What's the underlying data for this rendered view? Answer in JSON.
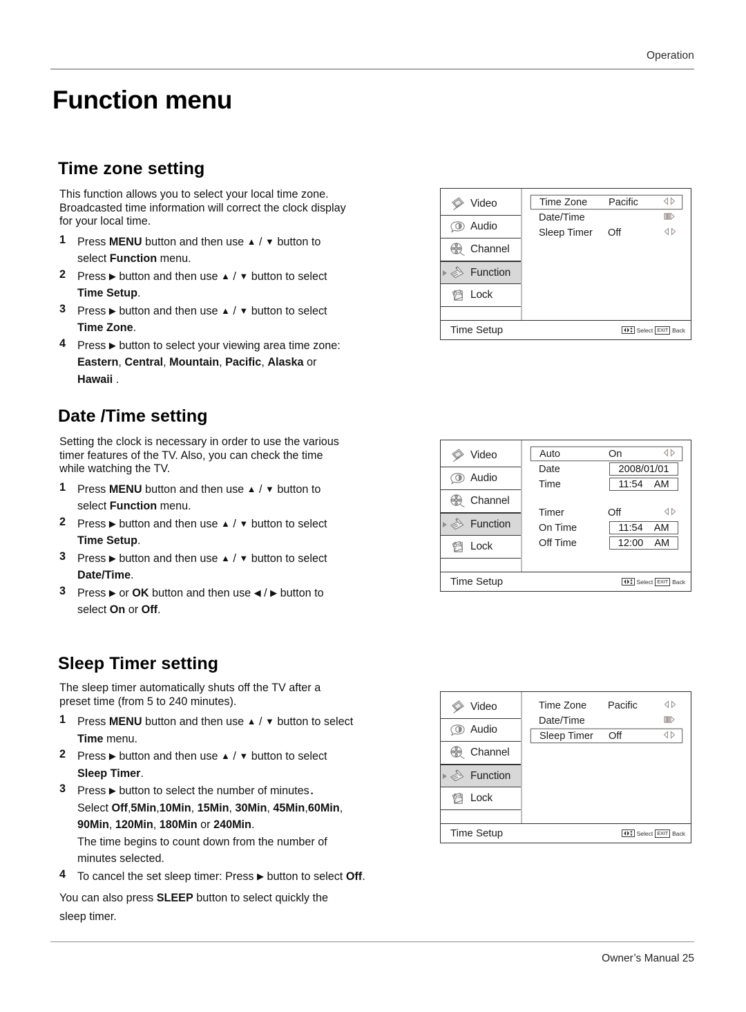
{
  "page": {
    "header_right": "Operation",
    "footer_right": "Owner’s Manual 25",
    "title": "Function menu"
  },
  "sections": [
    {
      "heading": "Time zone setting",
      "intro": [
        "This function allows you to select your local time zone.",
        "Broadcasted time information will correct the clock display",
        "for your local time."
      ],
      "steps": [
        {
          "num": "1",
          "lines": [
            "Press MENU button and then use ▲ / ▼ button to",
            "select Function menu."
          ]
        },
        {
          "num": "2",
          "lines": [
            "Press ▶ button and then use ▲ / ▼ button to select",
            "Time Setup."
          ]
        },
        {
          "num": "3",
          "lines": [
            "Press ▶ button and then use ▲ / ▼ button to select",
            "Time Zone."
          ]
        },
        {
          "num": "4",
          "lines": [
            "Press ▶ button to select your viewing area time zone:",
            "Eastern, Central, Mountain, Pacific, Alaska or",
            "Hawaii ."
          ]
        }
      ]
    },
    {
      "heading": "Date /Time setting",
      "intro": [
        "Setting the clock is necessary in order to use the various",
        "timer features of the TV. Also, you can check the time",
        "while watching the TV."
      ],
      "steps": [
        {
          "num": "1",
          "lines": [
            "Press MENU button and then use ▲ / ▼ button to",
            "select Function menu."
          ]
        },
        {
          "num": "2",
          "lines": [
            "Press ▶ button and then use ▲ / ▼ button to select",
            "Time Setup."
          ]
        },
        {
          "num": "3",
          "lines": [
            "Press ▶ button and then use ▲ / ▼ button to select",
            "Date/Time."
          ]
        },
        {
          "num": "3",
          "lines": [
            "Press ▶ or OK button and then use ◀ / ▶ button to",
            "select On or Off."
          ]
        }
      ]
    },
    {
      "heading": "Sleep Timer setting",
      "intro": [
        "The sleep timer automatically shuts off the TV after a",
        "preset time (from 5 to 240 minutes)."
      ],
      "steps": [
        {
          "num": "1",
          "lines": [
            "Press MENU button and then use ▲ / ▼ button to select",
            "Time menu."
          ]
        },
        {
          "num": "2",
          "lines": [
            "Press ▶ button and then use ▲ / ▼ button to select",
            "Sleep Timer."
          ]
        },
        {
          "num": "3",
          "lines": [
            "Press ▶ button to select the number of minutes．",
            "Select Off,5Min,10Min, 15Min, 30Min, 45Min,60Min,",
            "90Min, 120Min, 180Min or 240Min.",
            "The time begins to count down from the number of",
            "minutes selected."
          ]
        },
        {
          "num": "4",
          "lines": [
            "To cancel the set sleep timer: Press ▶ button to select Off."
          ]
        }
      ],
      "note": [
        "You can also press SLEEP button to select quickly the",
        "sleep timer."
      ]
    }
  ],
  "osd_sidebar": [
    {
      "label": "Video",
      "icon": "video-icon",
      "active": false
    },
    {
      "label": "Audio",
      "icon": "audio-icon",
      "active": false
    },
    {
      "label": "Channel",
      "icon": "channel-icon",
      "active": false
    },
    {
      "label": "Function",
      "icon": "function-icon",
      "active": true
    },
    {
      "label": "Lock",
      "icon": "lock-icon",
      "active": false
    }
  ],
  "osd_footer": {
    "title": "Time Setup",
    "select_label": "Select",
    "exit_key": "EXIT",
    "back_label": "Back"
  },
  "osd_screens": [
    {
      "name": "time-zone-screen",
      "rows": [
        {
          "label": "Time Zone",
          "value": "Pacific",
          "indicator": "leftright-arrows",
          "selected": true,
          "field": false
        },
        {
          "label": "Date/Time",
          "value": "",
          "indicator": "submenu-arrow",
          "selected": false,
          "field": false
        },
        {
          "label": "Sleep Timer",
          "value": "Off",
          "indicator": "leftright-arrows",
          "selected": false,
          "field": false
        }
      ]
    },
    {
      "name": "date-time-screen",
      "rows": [
        {
          "label": "Auto",
          "value": "On",
          "indicator": "leftright-arrows",
          "selected": true,
          "field": false
        },
        {
          "label": "Date",
          "value": "2008/01/01",
          "value2": "",
          "indicator": "",
          "selected": false,
          "field": true
        },
        {
          "label": "Time",
          "value": "11:54",
          "value2": "AM",
          "indicator": "",
          "selected": false,
          "field": true
        },
        {
          "label": "",
          "value": "",
          "indicator": "",
          "selected": false,
          "field": false,
          "spacer": true
        },
        {
          "label": "Timer",
          "value": "Off",
          "indicator": "leftright-arrows",
          "selected": false,
          "field": false
        },
        {
          "label": "On Time",
          "value": "11:54",
          "value2": "AM",
          "indicator": "",
          "selected": false,
          "field": true
        },
        {
          "label": "Off Time",
          "value": "12:00",
          "value2": "AM",
          "indicator": "",
          "selected": false,
          "field": true
        }
      ]
    },
    {
      "name": "sleep-timer-screen",
      "rows": [
        {
          "label": "Time Zone",
          "value": "Pacific",
          "indicator": "leftright-arrows",
          "selected": false,
          "field": false
        },
        {
          "label": "Date/Time",
          "value": "",
          "indicator": "submenu-arrow",
          "selected": false,
          "field": false
        },
        {
          "label": "Sleep Timer",
          "value": "Off",
          "indicator": "leftright-arrows",
          "selected": true,
          "field": false
        }
      ]
    }
  ]
}
